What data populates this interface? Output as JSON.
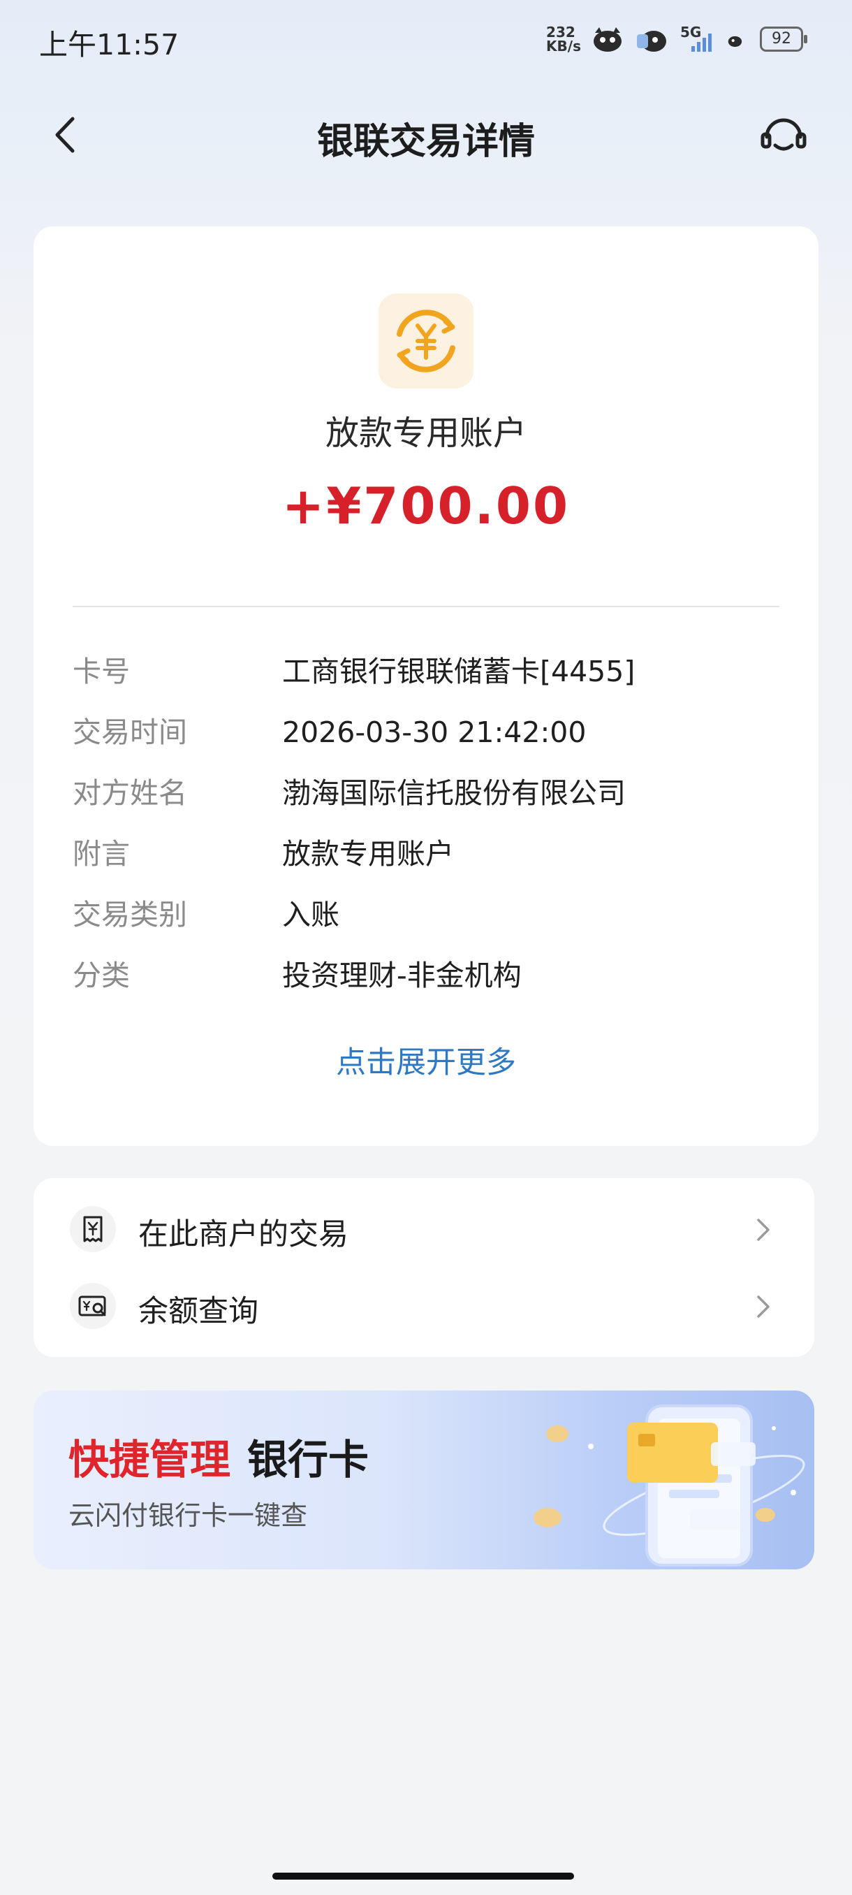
{
  "status_bar": {
    "time": "上午11:57",
    "net_speed_value": "232",
    "net_speed_unit": "KB/s",
    "signal_label": "5G",
    "battery": "92"
  },
  "nav": {
    "title": "银联交易详情"
  },
  "transaction": {
    "payee": "放款专用账户",
    "amount": "+¥700.00",
    "details": [
      {
        "label": "卡号",
        "value": "工商银行银联储蓄卡[4455]"
      },
      {
        "label": "交易时间",
        "value": "2026-03-30 21:42:00"
      },
      {
        "label": "对方姓名",
        "value": "渤海国际信托股份有限公司"
      },
      {
        "label": "附言",
        "value": "放款专用账户"
      },
      {
        "label": "交易类别",
        "value": "入账"
      },
      {
        "label": "分类",
        "value": "投资理财-非金机构"
      }
    ],
    "expand_link": "点击展开更多"
  },
  "actions": [
    {
      "label": "在此商户的交易",
      "icon": "receipt-icon"
    },
    {
      "label": "余额查询",
      "icon": "balance-search-icon"
    }
  ],
  "banner": {
    "title_highlight": "快捷管理",
    "title_rest": "银行卡",
    "subtitle": "云闪付银行卡一键查"
  },
  "colors": {
    "amount": "#d6202a",
    "link": "#2f78c4",
    "banner_highlight": "#e0242c",
    "icon_accent": "#f1a51f"
  }
}
